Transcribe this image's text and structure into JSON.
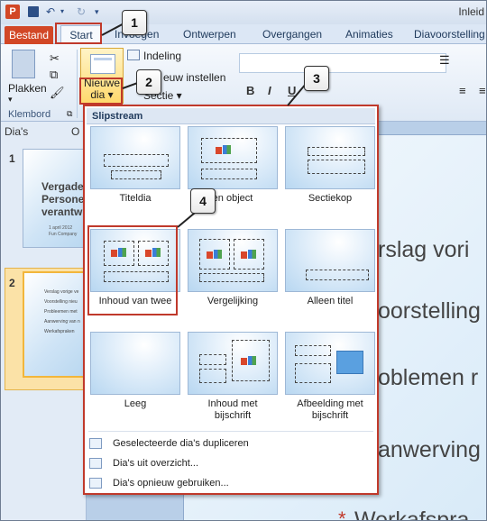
{
  "title_bar": {
    "app_icon": "P",
    "title": "Inleid"
  },
  "quick_access": {
    "save_icon": "save-icon",
    "undo_icon": "undo-icon",
    "redo_icon": "redo-icon"
  },
  "tabs": {
    "file": "Bestand",
    "active": "Start",
    "items": [
      "Invoegen",
      "Ontwerpen",
      "Overgangen",
      "Animaties",
      "Diavoorstelling"
    ]
  },
  "ribbon": {
    "paste_label": "Plakken",
    "clipboard_group": "Klembord",
    "new_slide_label_1": "Nieuwe",
    "new_slide_label_2": "dia ▾",
    "layout_label": "Indeling",
    "reset_label": "euw instellen",
    "section_label": "Sectie ▾",
    "format_buttons": [
      "B",
      "I",
      "U"
    ]
  },
  "left_panel": {
    "tab_slides": "Dia's",
    "tab_outline": "O",
    "thumbnails": [
      {
        "number": "1",
        "title_lines": [
          "Vergade",
          "Persone",
          "verantw"
        ],
        "sub": [
          "1 april 2012",
          "Fun Company"
        ]
      },
      {
        "number": "2",
        "bullets": [
          "Verslag vorige ve",
          "Voorstelling nieu",
          "Probleemen met",
          "Aanwerving van n",
          "Werkafspraken"
        ]
      }
    ]
  },
  "slide": {
    "lines": [
      "rslag vori",
      "oorstelling",
      "oblemen r",
      "anwerving",
      "Werkafspra"
    ],
    "bullet_star": "*"
  },
  "gallery": {
    "header": "Slipstream",
    "layouts": [
      {
        "name": "Titeldia"
      },
      {
        "name": "en object"
      },
      {
        "name": "Sectiekop"
      },
      {
        "name": "Inhoud van twee"
      },
      {
        "name": "Vergelijking"
      },
      {
        "name": "Alleen titel"
      },
      {
        "name": "Leeg"
      },
      {
        "name": "Inhoud met\nbijschrift"
      },
      {
        "name": "Afbeelding met\nbijschrift"
      }
    ],
    "menu": [
      {
        "label": "Geselecteerde dia's dupliceren"
      },
      {
        "label": "Dia's uit overzicht..."
      },
      {
        "label": "Dia's opnieuw gebruiken..."
      }
    ]
  },
  "callouts": [
    "1",
    "2",
    "3",
    "4"
  ],
  "colors": {
    "accent": "#c0392b",
    "file_tab": "#d24726",
    "selection": "#f2b63b"
  }
}
